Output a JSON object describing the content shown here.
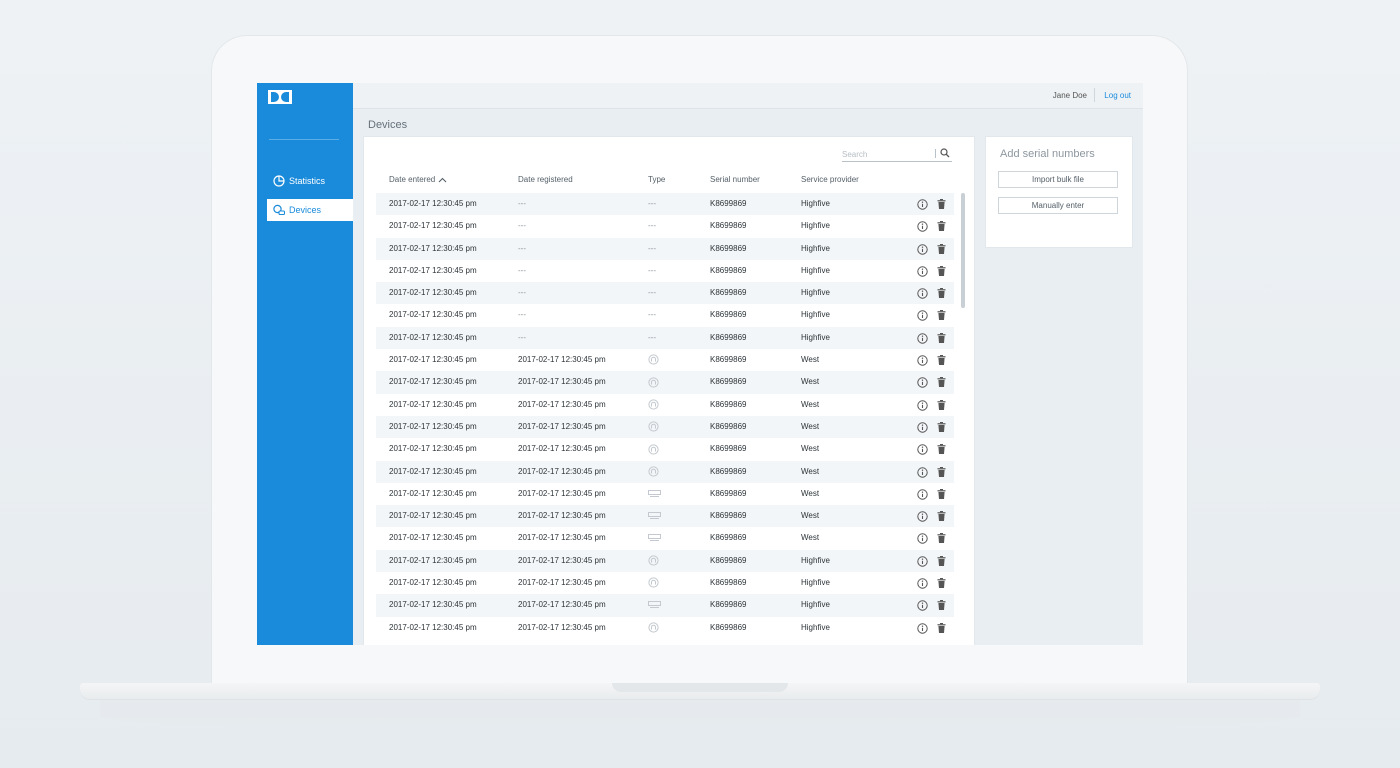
{
  "header": {
    "user_name": "Jane Doe",
    "logout_label": "Log out"
  },
  "sidebar": {
    "items": [
      {
        "label": "Statistics",
        "active": false,
        "icon": "pie-chart-icon"
      },
      {
        "label": "Devices",
        "active": true,
        "icon": "devices-icon"
      }
    ]
  },
  "page": {
    "title": "Devices"
  },
  "search": {
    "placeholder": "Search"
  },
  "table": {
    "columns": [
      "Date entered",
      "Date registered",
      "Type",
      "Serial number",
      "Service provider"
    ],
    "sort": {
      "column": "Date entered",
      "direction": "ascending"
    },
    "rows": [
      {
        "entered": "2017-02-17 12:30:45 pm",
        "registered": "---",
        "type": "---",
        "serial": "K8699869",
        "provider": "Highfive"
      },
      {
        "entered": "2017-02-17 12:30:45 pm",
        "registered": "---",
        "type": "---",
        "serial": "K8699869",
        "provider": "Highfive"
      },
      {
        "entered": "2017-02-17 12:30:45 pm",
        "registered": "---",
        "type": "---",
        "serial": "K8699869",
        "provider": "Highfive"
      },
      {
        "entered": "2017-02-17 12:30:45 pm",
        "registered": "---",
        "type": "---",
        "serial": "K8699869",
        "provider": "Highfive"
      },
      {
        "entered": "2017-02-17 12:30:45 pm",
        "registered": "---",
        "type": "---",
        "serial": "K8699869",
        "provider": "Highfive"
      },
      {
        "entered": "2017-02-17 12:30:45 pm",
        "registered": "---",
        "type": "---",
        "serial": "K8699869",
        "provider": "Highfive"
      },
      {
        "entered": "2017-02-17 12:30:45 pm",
        "registered": "---",
        "type": "---",
        "serial": "K8699869",
        "provider": "Highfive"
      },
      {
        "entered": "2017-02-17 12:30:45 pm",
        "registered": "2017-02-17 12:30:45 pm",
        "type": "round-device-icon",
        "serial": "K8699869",
        "provider": "West"
      },
      {
        "entered": "2017-02-17 12:30:45 pm",
        "registered": "2017-02-17 12:30:45 pm",
        "type": "round-device-icon",
        "serial": "K8699869",
        "provider": "West"
      },
      {
        "entered": "2017-02-17 12:30:45 pm",
        "registered": "2017-02-17 12:30:45 pm",
        "type": "round-device-icon",
        "serial": "K8699869",
        "provider": "West"
      },
      {
        "entered": "2017-02-17 12:30:45 pm",
        "registered": "2017-02-17 12:30:45 pm",
        "type": "round-device-icon",
        "serial": "K8699869",
        "provider": "West"
      },
      {
        "entered": "2017-02-17 12:30:45 pm",
        "registered": "2017-02-17 12:30:45 pm",
        "type": "round-device-icon",
        "serial": "K8699869",
        "provider": "West"
      },
      {
        "entered": "2017-02-17 12:30:45 pm",
        "registered": "2017-02-17 12:30:45 pm",
        "type": "round-device-icon",
        "serial": "K8699869",
        "provider": "West"
      },
      {
        "entered": "2017-02-17 12:30:45 pm",
        "registered": "2017-02-17 12:30:45 pm",
        "type": "bar-device-icon",
        "serial": "K8699869",
        "provider": "West"
      },
      {
        "entered": "2017-02-17 12:30:45 pm",
        "registered": "2017-02-17 12:30:45 pm",
        "type": "bar-device-icon",
        "serial": "K8699869",
        "provider": "West"
      },
      {
        "entered": "2017-02-17 12:30:45 pm",
        "registered": "2017-02-17 12:30:45 pm",
        "type": "bar-device-icon",
        "serial": "K8699869",
        "provider": "West"
      },
      {
        "entered": "2017-02-17 12:30:45 pm",
        "registered": "2017-02-17 12:30:45 pm",
        "type": "round-device-icon",
        "serial": "K8699869",
        "provider": "Highfive"
      },
      {
        "entered": "2017-02-17 12:30:45 pm",
        "registered": "2017-02-17 12:30:45 pm",
        "type": "round-device-icon",
        "serial": "K8699869",
        "provider": "Highfive"
      },
      {
        "entered": "2017-02-17 12:30:45 pm",
        "registered": "2017-02-17 12:30:45 pm",
        "type": "bar-device-icon",
        "serial": "K8699869",
        "provider": "Highfive"
      },
      {
        "entered": "2017-02-17 12:30:45 pm",
        "registered": "2017-02-17 12:30:45 pm",
        "type": "round-device-icon",
        "serial": "K8699869",
        "provider": "Highfive"
      }
    ]
  },
  "add_panel": {
    "title": "Add serial numbers",
    "import_label": "Import bulk file",
    "manual_label": "Manually enter"
  },
  "colors": {
    "accent": "#1a8bdb",
    "row_shade": "#f3f6f8",
    "background": "#e9eef2"
  }
}
